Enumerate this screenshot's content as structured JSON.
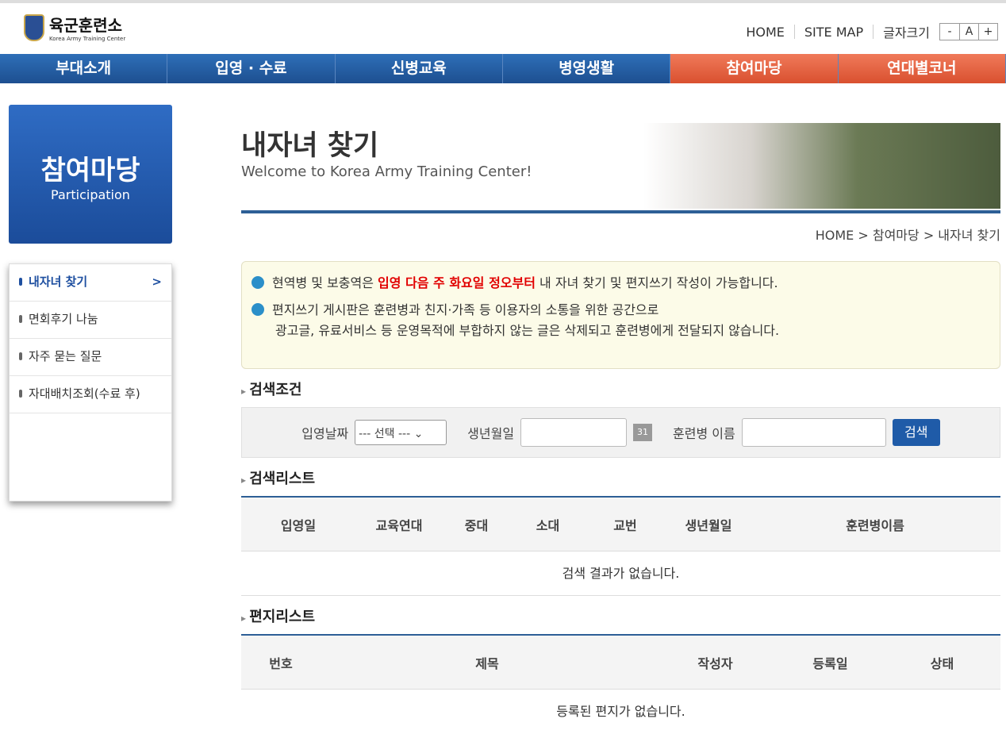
{
  "logo": {
    "title": "육군훈련소",
    "sub": "Korea Army Training Center"
  },
  "util": {
    "home": "HOME",
    "sitemap": "SITE MAP",
    "font": "글자크기",
    "minus": "-",
    "a": "A",
    "plus": "+"
  },
  "gnb": [
    "부대소개",
    "입영 · 수료",
    "신병교육",
    "병영생활",
    "참여마당",
    "연대별코너"
  ],
  "side": {
    "title": "참여마당",
    "sub": "Participation",
    "items": [
      "내자녀 찾기",
      "면회후기 나눔",
      "자주 묻는 질문",
      "자대배치조회(수료 후)"
    ],
    "arrow": ">"
  },
  "page": {
    "title": "내자녀 찾기",
    "welcome": "Welcome to Korea Army Training Center!",
    "loc": "HOME > 참여마당 > 내자녀 찾기"
  },
  "notice": {
    "a1": "현역병 및 보충역은 ",
    "a2": "입영 다음 주 화요일 정오부터",
    "a3": " 내 자녀 찾기 및 편지쓰기 작성이 가능합니다.",
    "b1": "편지쓰기 게시판은 훈련병과 친지·가족 등 이용자의 소통을 위한 공간으로",
    "b2": "광고글, 유료서비스 등 운영목적에 부합하지 않는 글은 삭제되고 훈련병에게 전달되지 않습니다."
  },
  "search": {
    "heading": "검색조건",
    "date": "입영날짜",
    "select": "--- 선택 --- ⌄",
    "birth": "생년월일",
    "name": "훈련병 이름",
    "btn": "검색"
  },
  "list": {
    "heading": "검색리스트",
    "cols": [
      "입영일",
      "교육연대",
      "중대",
      "소대",
      "교번",
      "생년월일",
      "훈련병이름"
    ],
    "empty": "검색 결과가 없습니다."
  },
  "letters": {
    "heading": "편지리스트",
    "cols": [
      "번호",
      "제목",
      "작성자",
      "등록일",
      "상태"
    ],
    "empty": "등록된 편지가 없습니다."
  }
}
